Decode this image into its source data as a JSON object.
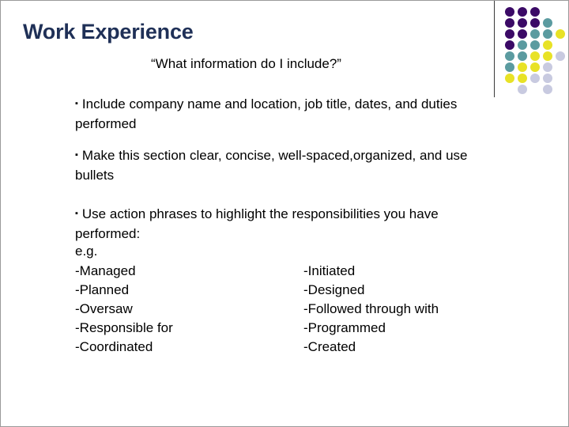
{
  "slide": {
    "title": "Work Experience",
    "subtitle": "“What information do I include?”",
    "bullet_glyph": "▪",
    "bullets": [
      "Include company name and location, job title, dates, and duties performed",
      "Make this section clear, concise, well-spaced,organized, and use bullets",
      "Use action phrases to highlight the responsibilities you have performed:"
    ],
    "example_label": "e.g.",
    "action_verbs": {
      "left_column": [
        "-Managed",
        "-Planned",
        "-Oversaw",
        "-Responsible for",
        "-Coordinated"
      ],
      "right_column": [
        "-Initiated",
        "-Designed",
        "-Followed through with",
        "-Programmed",
        "-Created"
      ]
    }
  },
  "colors": {
    "title": "#1f3057",
    "body_text": "#000000",
    "slide_background": "#ffffff",
    "slide_border": "#9a9a9a",
    "deco_rule": "#3a3a3a",
    "deco_purple": "#3b0a66",
    "deco_teal": "#5b9ba0",
    "deco_yellow": "#e8e226",
    "deco_lavender": "#c8cae0"
  },
  "decoration": {
    "name": "dot-grid",
    "columns": 5,
    "rows": 9,
    "dots": [
      {
        "col": 0,
        "row": 0,
        "color": "#3b0a66"
      },
      {
        "col": 1,
        "row": 0,
        "color": "#3b0a66"
      },
      {
        "col": 2,
        "row": 0,
        "color": "#3b0a66"
      },
      {
        "col": 0,
        "row": 1,
        "color": "#3b0a66"
      },
      {
        "col": 1,
        "row": 1,
        "color": "#3b0a66"
      },
      {
        "col": 2,
        "row": 1,
        "color": "#3b0a66"
      },
      {
        "col": 3,
        "row": 1,
        "color": "#5b9ba0"
      },
      {
        "col": 0,
        "row": 2,
        "color": "#3b0a66"
      },
      {
        "col": 1,
        "row": 2,
        "color": "#3b0a66"
      },
      {
        "col": 2,
        "row": 2,
        "color": "#5b9ba0"
      },
      {
        "col": 3,
        "row": 2,
        "color": "#5b9ba0"
      },
      {
        "col": 4,
        "row": 2,
        "color": "#e8e226"
      },
      {
        "col": 0,
        "row": 3,
        "color": "#3b0a66"
      },
      {
        "col": 1,
        "row": 3,
        "color": "#5b9ba0"
      },
      {
        "col": 2,
        "row": 3,
        "color": "#5b9ba0"
      },
      {
        "col": 3,
        "row": 3,
        "color": "#e8e226"
      },
      {
        "col": 0,
        "row": 4,
        "color": "#5b9ba0"
      },
      {
        "col": 1,
        "row": 4,
        "color": "#5b9ba0"
      },
      {
        "col": 2,
        "row": 4,
        "color": "#e8e226"
      },
      {
        "col": 3,
        "row": 4,
        "color": "#e8e226"
      },
      {
        "col": 4,
        "row": 4,
        "color": "#c8cae0"
      },
      {
        "col": 0,
        "row": 5,
        "color": "#5b9ba0"
      },
      {
        "col": 1,
        "row": 5,
        "color": "#e8e226"
      },
      {
        "col": 2,
        "row": 5,
        "color": "#e8e226"
      },
      {
        "col": 3,
        "row": 5,
        "color": "#c8cae0"
      },
      {
        "col": 0,
        "row": 6,
        "color": "#e8e226"
      },
      {
        "col": 1,
        "row": 6,
        "color": "#e8e226"
      },
      {
        "col": 2,
        "row": 6,
        "color": "#c8cae0"
      },
      {
        "col": 3,
        "row": 6,
        "color": "#c8cae0"
      },
      {
        "col": 1,
        "row": 7,
        "color": "#c8cae0"
      },
      {
        "col": 3,
        "row": 7,
        "color": "#c8cae0"
      }
    ]
  }
}
